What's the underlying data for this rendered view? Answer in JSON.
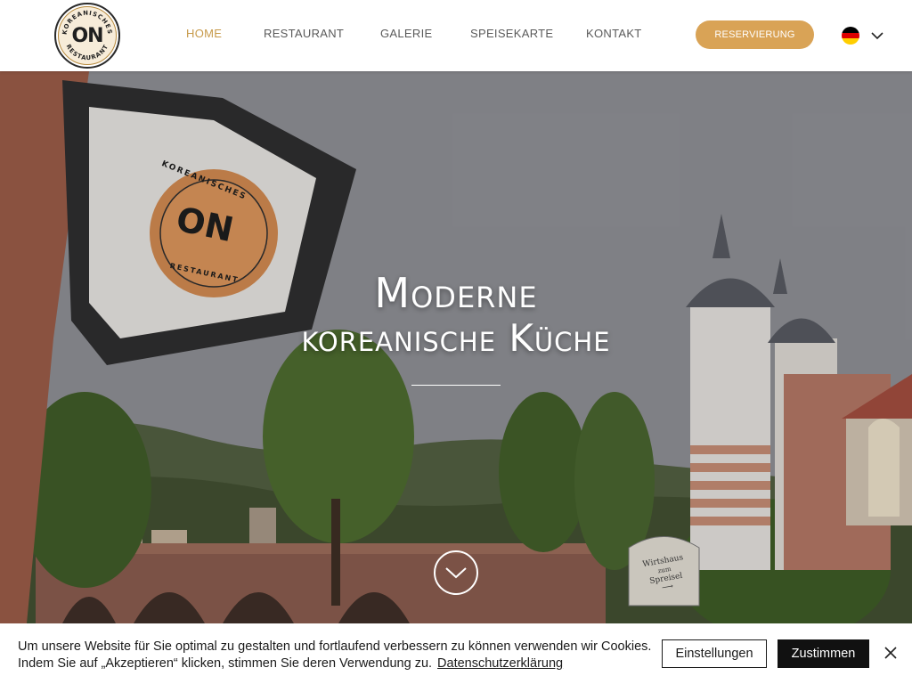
{
  "header": {
    "logo": {
      "main_text": "ON",
      "ring_top": "KOREANISCHES",
      "ring_bottom": "RESTAURANT"
    },
    "nav": [
      {
        "label": "HOME",
        "active": true
      },
      {
        "label": "RESTAURANT",
        "active": false
      },
      {
        "label": "GALERIE",
        "active": false
      },
      {
        "label": "SPEISEKARTE",
        "active": false
      },
      {
        "label": "KONTAKT",
        "active": false
      }
    ],
    "reserve_label": "RESERVIERUNG",
    "language": {
      "flag_icon": "germany-flag-icon",
      "chevron_icon": "chevron-down-icon"
    }
  },
  "hero": {
    "title_line1": "Moderne",
    "title_line2": "koreanische Küche",
    "lantern_sign": {
      "main": "ON",
      "ring_top": "KOREANISCHES",
      "ring_bottom": "RESTAURANT"
    },
    "street_sign": {
      "line1": "Wirtshaus",
      "line2": "zum",
      "line3": "Spreisel"
    },
    "scroll_icon": "chevron-down-circle-icon"
  },
  "cookie_banner": {
    "text_line1": "Um unsere Website für Sie optimal zu gestalten und fortlaufend verbessern zu können verwenden wir Cookies.",
    "text_line2": "Indem Sie auf „Akzeptieren“ klicken, stimmen Sie deren Verwendung zu.",
    "privacy_link": "Datenschutzerklärung",
    "settings_label": "Einstellungen",
    "accept_label": "Zustimmen",
    "close_icon": "close-icon"
  },
  "colors": {
    "accent": "#d9a356",
    "nav_active": "#c79a4a",
    "nav_text": "#5a5a5a",
    "accept_button": "#111111"
  }
}
